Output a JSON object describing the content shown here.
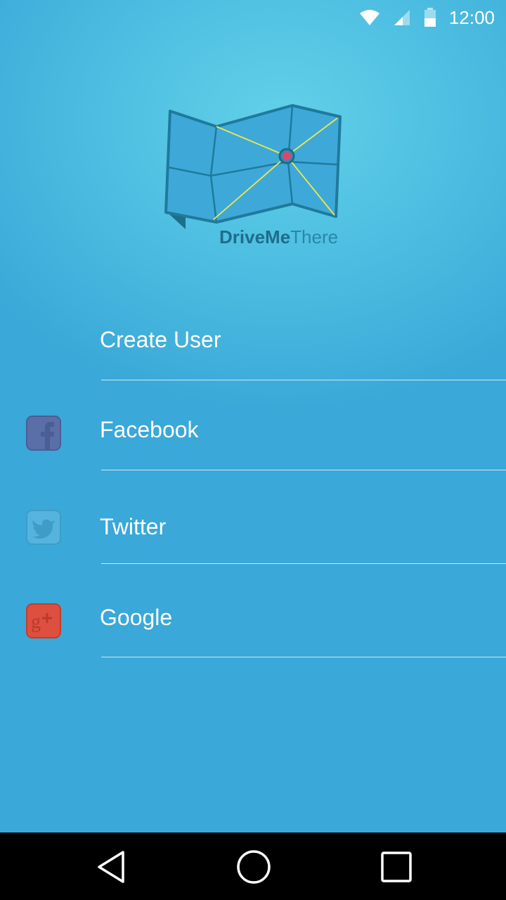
{
  "status_bar": {
    "time": "12:00",
    "icons": [
      "wifi-icon",
      "signal-icon",
      "battery-icon"
    ]
  },
  "logo": {
    "brand_part1": "DriveMe",
    "brand_part2": "There"
  },
  "menu": {
    "items": [
      {
        "label": "Create User",
        "icon": null
      },
      {
        "label": "Facebook",
        "icon": "facebook-icon"
      },
      {
        "label": "Twitter",
        "icon": "twitter-icon"
      },
      {
        "label": "Google",
        "icon": "google-plus-icon"
      }
    ]
  },
  "navigation_bar": {
    "buttons": [
      "back-icon",
      "home-icon",
      "recents-icon"
    ]
  },
  "colors": {
    "background_top": "#62d0e8",
    "background_bottom": "#3aa8d8",
    "facebook": "#5a6fa8",
    "twitter": "#55b3dd",
    "google": "#dd4f3f"
  }
}
